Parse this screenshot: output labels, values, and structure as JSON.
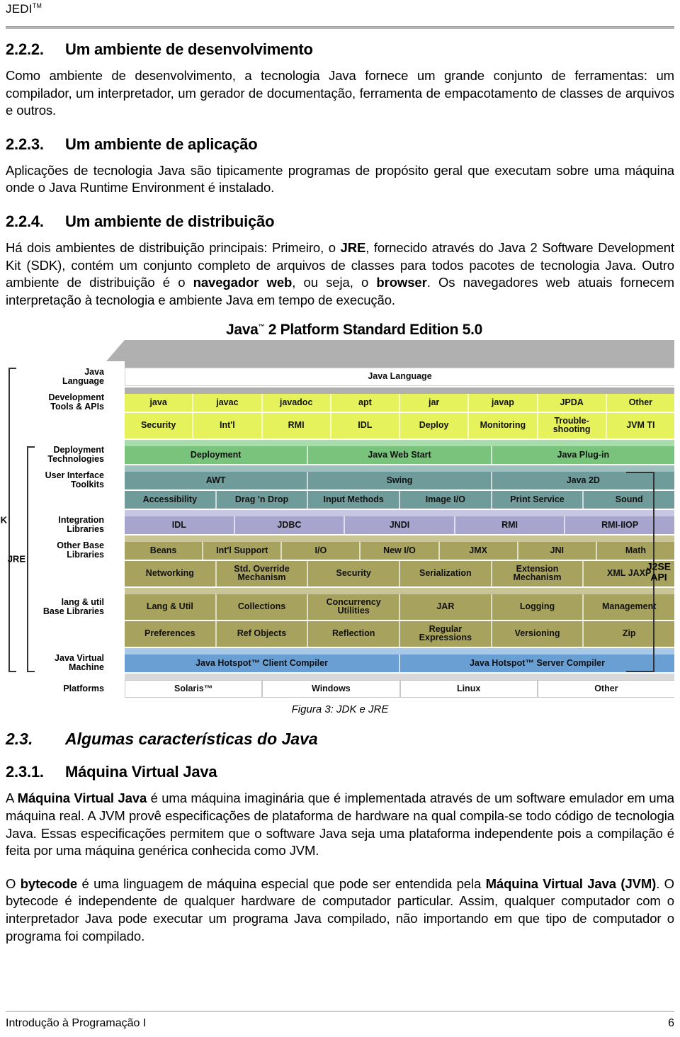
{
  "header": {
    "doc_label": "JEDI",
    "doc_label_sup": "TM"
  },
  "sections": [
    {
      "number": "2.2.2.",
      "title": "Um ambiente de desenvolvimento",
      "paragraph": "Como ambiente de desenvolvimento, a tecnologia Java fornece um grande conjunto de ferramentas: um compilador, um interpretador, um gerador de documentação, ferramenta de empacotamento de classes de arquivos e outros."
    },
    {
      "number": "2.2.3.",
      "title": "Um ambiente de aplicação",
      "paragraph": "Aplicações de tecnologia Java são tipicamente programas de propósito geral que executam sobre uma máquina onde o Java Runtime Environment é instalado."
    },
    {
      "number": "2.2.4.",
      "title": "Um ambiente de distribuição"
    }
  ],
  "distribution_paragraph": {
    "p1": "Há dois ambientes de distribuição principais: Primeiro, o ",
    "b1": "JRE",
    "p2": ", fornecido através do Java 2 Software Development Kit (SDK), contém um conjunto completo de arquivos de classes para todos pacotes de tecnologia Java. Outro ambiente de distribuição é o ",
    "b2": "navegador web",
    "p3": ", ou seja, o ",
    "b3": "browser",
    "p4": ". Os navegadores web atuais fornecem interpretação à tecnologia e ambiente Java em tempo de execução."
  },
  "figure": {
    "title": "Java",
    "title_sup": "™",
    "title_rest": " 2 Platform Standard Edition 5.0",
    "caption": "Figura 3: JDK e JRE",
    "left_brackets": [
      {
        "label": "JDK"
      },
      {
        "label": "JRE"
      }
    ],
    "right_bracket_label": "J2SE\nAPI",
    "right_bracket_line1": "J2SE",
    "right_bracket_line2": "API",
    "row_labels": [
      "Java\nLanguage",
      "Development\nTools & APIs",
      "Deployment\nTechnologies",
      "User Interface\nToolkits",
      "Integration\nLibraries",
      "Other Base\nLibraries",
      "lang & util\nBase Libraries",
      "Java Virtual\nMachine",
      "Platforms"
    ],
    "rows": [
      {
        "name": "java-language",
        "color": "white",
        "cells": [
          "Java Language"
        ]
      },
      {
        "name": "dev-tools-1",
        "color": "yellow",
        "cells": [
          "java",
          "javac",
          "javadoc",
          "apt",
          "jar",
          "javap",
          "JPDA",
          "Other"
        ]
      },
      {
        "name": "dev-tools-2",
        "color": "yellow",
        "cells": [
          "Security",
          "Int'l",
          "RMI",
          "IDL",
          "Deploy",
          "Monitoring",
          "Trouble-shooting",
          "JVM TI"
        ]
      },
      {
        "name": "deployment",
        "color": "green",
        "cells": [
          "Deployment",
          "Java Web Start",
          "Java Plug-in"
        ]
      },
      {
        "name": "ui-toolkits-1",
        "color": "teal",
        "cells": [
          "AWT",
          "Swing",
          "Java 2D"
        ]
      },
      {
        "name": "ui-toolkits-2",
        "color": "teal",
        "cells": [
          "Accessibility",
          "Drag 'n Drop",
          "Input Methods",
          "Image I/O",
          "Print Service",
          "Sound"
        ]
      },
      {
        "name": "integration-libraries",
        "color": "purple",
        "cells": [
          "IDL",
          "JDBC",
          "JNDI",
          "RMI",
          "RMI-IIOP"
        ]
      },
      {
        "name": "other-base-1",
        "color": "olive",
        "cells": [
          "Beans",
          "Int'l Support",
          "I/O",
          "New I/O",
          "JMX",
          "JNI",
          "Math"
        ]
      },
      {
        "name": "other-base-2",
        "color": "olive",
        "cells": [
          "Networking",
          "Std. Override Mechanism",
          "Security",
          "Serialization",
          "Extension Mechanism",
          "XML JAXP"
        ]
      },
      {
        "name": "lang-util-1",
        "color": "olive",
        "cells": [
          "Lang & Util",
          "Collections",
          "Concurrency Utilities",
          "JAR",
          "Logging",
          "Management"
        ]
      },
      {
        "name": "lang-util-2",
        "color": "olive",
        "cells": [
          "Preferences",
          "Ref Objects",
          "Reflection",
          "Regular Expressions",
          "Versioning",
          "Zip"
        ]
      },
      {
        "name": "jvm",
        "color": "blue",
        "cells": [
          "Java Hotspot™ Client Compiler",
          "Java Hotspot™ Server Compiler"
        ]
      },
      {
        "name": "platforms",
        "color": "plat",
        "cells": [
          "Solaris™",
          "Windows",
          "Linux",
          "Other"
        ]
      }
    ]
  },
  "section_23": {
    "number": "2.3.",
    "title": "Algumas características do Java"
  },
  "section_231": {
    "number": "2.3.1.",
    "title": "Máquina Virtual Java"
  },
  "jvm_paragraph": {
    "p1": "A ",
    "b1": "Máquina Virtual Java",
    "p2": " é uma máquina imaginária que é implementada através de um software emulador em uma máquina real. A JVM provê especificações de plataforma de hardware na qual compila-se todo código de tecnologia Java. Essas especificações permitem que o software Java seja uma plataforma independente pois a compilação é feita por uma máquina genérica conhecida como JVM."
  },
  "bytecode_paragraph": {
    "p1": "O ",
    "b1": "bytecode",
    "p2": " é uma linguagem de máquina especial que pode ser entendida pela ",
    "b2": "Máquina Virtual Java (JVM)",
    "p3": ". O bytecode é independente de qualquer hardware de computador particular. Assim, qualquer computador com o interpretador Java pode executar um programa Java compilado, não importando em que tipo de computador o programa foi compilado."
  },
  "footer": {
    "left": "Introdução à Programação I",
    "page": "6"
  },
  "colors": {
    "yellow": "#e6f25c",
    "green": "#79c37d",
    "teal": "#6f9b9b",
    "purple": "#a7a4cd",
    "olive": "#a7a25d",
    "blue": "#6a9fd4",
    "gray": "#b0b0b0"
  }
}
